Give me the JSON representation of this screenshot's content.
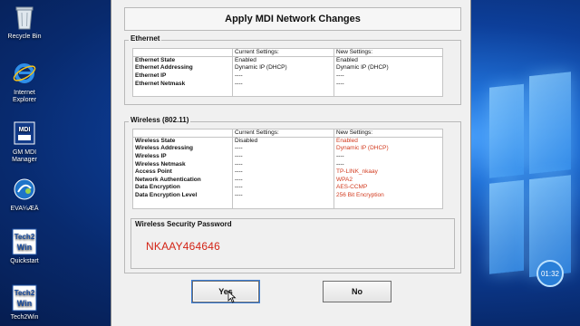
{
  "desktop": {
    "icons": [
      {
        "label": "Recycle Bin",
        "icon": "recycle-bin-icon"
      },
      {
        "label": "Internet Explorer",
        "icon": "internet-explorer-icon"
      },
      {
        "label": "GM MDI Manager",
        "icon": "gm-mdi-icon"
      },
      {
        "label": "EVA¼ÆÄ",
        "icon": "eva-icon"
      },
      {
        "label": "Quickstart",
        "icon": "tech2win-icon"
      },
      {
        "label": "Tech2Win",
        "icon": "tech2win-icon"
      }
    ],
    "clock": "01:32"
  },
  "dialog": {
    "title": "Apply MDI Network Changes",
    "ethernet": {
      "legend": "Ethernet",
      "headers": [
        "",
        "Current Settings:",
        "New Settings:"
      ],
      "rows": [
        {
          "name": "Ethernet State",
          "current": "Enabled",
          "new": "Enabled",
          "changed": false
        },
        {
          "name": "Ethernet Addressing",
          "current": "Dynamic IP (DHCP)",
          "new": "Dynamic IP (DHCP)",
          "changed": false
        },
        {
          "name": "Ethernet IP",
          "current": "----",
          "new": "----",
          "changed": false
        },
        {
          "name": "Ethernet Netmask",
          "current": "----",
          "new": "----",
          "changed": false
        }
      ]
    },
    "wireless": {
      "legend": "Wireless (802.11)",
      "headers": [
        "",
        "Current Settings:",
        "New Settings:"
      ],
      "rows": [
        {
          "name": "Wireless State",
          "current": "Disabled",
          "new": "Enabled",
          "changed": true
        },
        {
          "name": "Wireless Addressing",
          "current": "----",
          "new": "Dynamic IP (DHCP)",
          "changed": true
        },
        {
          "name": "Wireless IP",
          "current": "----",
          "new": "----",
          "changed": false
        },
        {
          "name": "Wireless Netmask",
          "current": "----",
          "new": "----",
          "changed": false
        },
        {
          "name": "Access Point",
          "current": "----",
          "new": "TP-LINK_nkaay",
          "changed": true
        },
        {
          "name": "Network Authentication",
          "current": "----",
          "new": "WPA2",
          "changed": true
        },
        {
          "name": "Data Encryption",
          "current": "----",
          "new": "AES-CCMP",
          "changed": true
        },
        {
          "name": "Data Encryption Level",
          "current": "----",
          "new": "256 Bit Encryption",
          "changed": true
        }
      ]
    },
    "password": {
      "label": "Wireless Security Password",
      "value": "NKAAY464646"
    },
    "buttons": {
      "yes": "Yes",
      "no": "No"
    }
  },
  "colors": {
    "changed_value": "#d23a1e",
    "password_text": "#d32416"
  }
}
